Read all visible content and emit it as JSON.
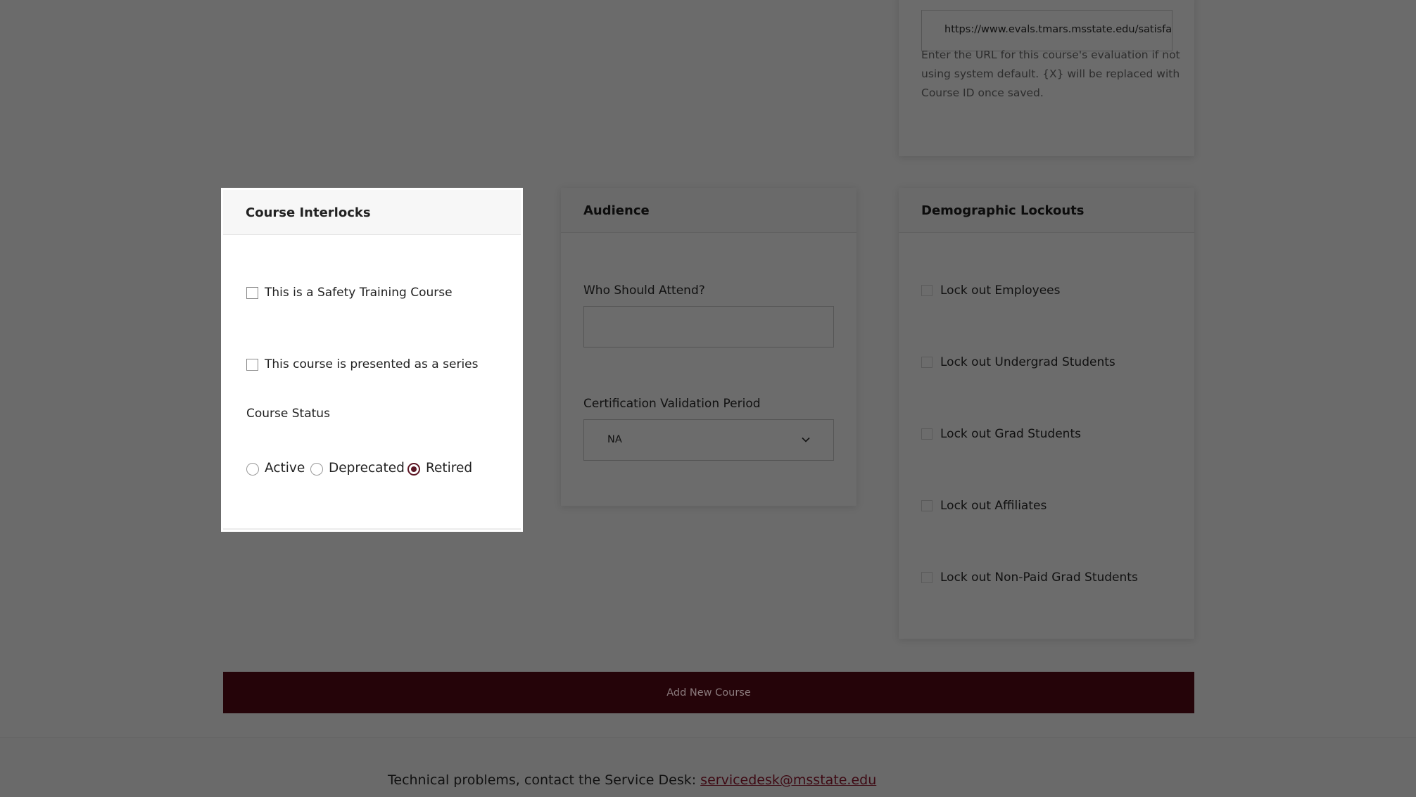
{
  "evaluation": {
    "url_value": "https://www.evals.tmars.msstate.edu/satisfa",
    "help_lines": [
      "Enter the URL for this course's evaluation if not",
      "using system default. {X} will be replaced with",
      "Course ID once saved."
    ]
  },
  "interlocks": {
    "title": "Course Interlocks",
    "safety_label": "This is a Safety Training Course",
    "series_label": "This course is presented as a series",
    "status_label": "Course Status",
    "status_options": [
      "Active",
      "Deprecated",
      "Retired"
    ],
    "status_selected": "Retired"
  },
  "audience": {
    "title": "Audience",
    "who_label": "Who Should Attend?",
    "who_value": "",
    "cert_label": "Certification Validation Period",
    "cert_selected": "NA"
  },
  "lockouts": {
    "title": "Demographic Lockouts",
    "items": [
      "Lock out Employees",
      "Lock out Undergrad Students",
      "Lock out Grad Students",
      "Lock out Affiliates",
      "Lock out Non-Paid Grad Students"
    ]
  },
  "actions": {
    "add_course_label": "Add New Course"
  },
  "footer": {
    "text": "Technical problems, contact the Service Desk:",
    "email": "servicedesk@msstate.edu"
  },
  "colors": {
    "accent": "#5d1725",
    "button_bg": "#250409",
    "overlay": "#6b6b6b"
  }
}
